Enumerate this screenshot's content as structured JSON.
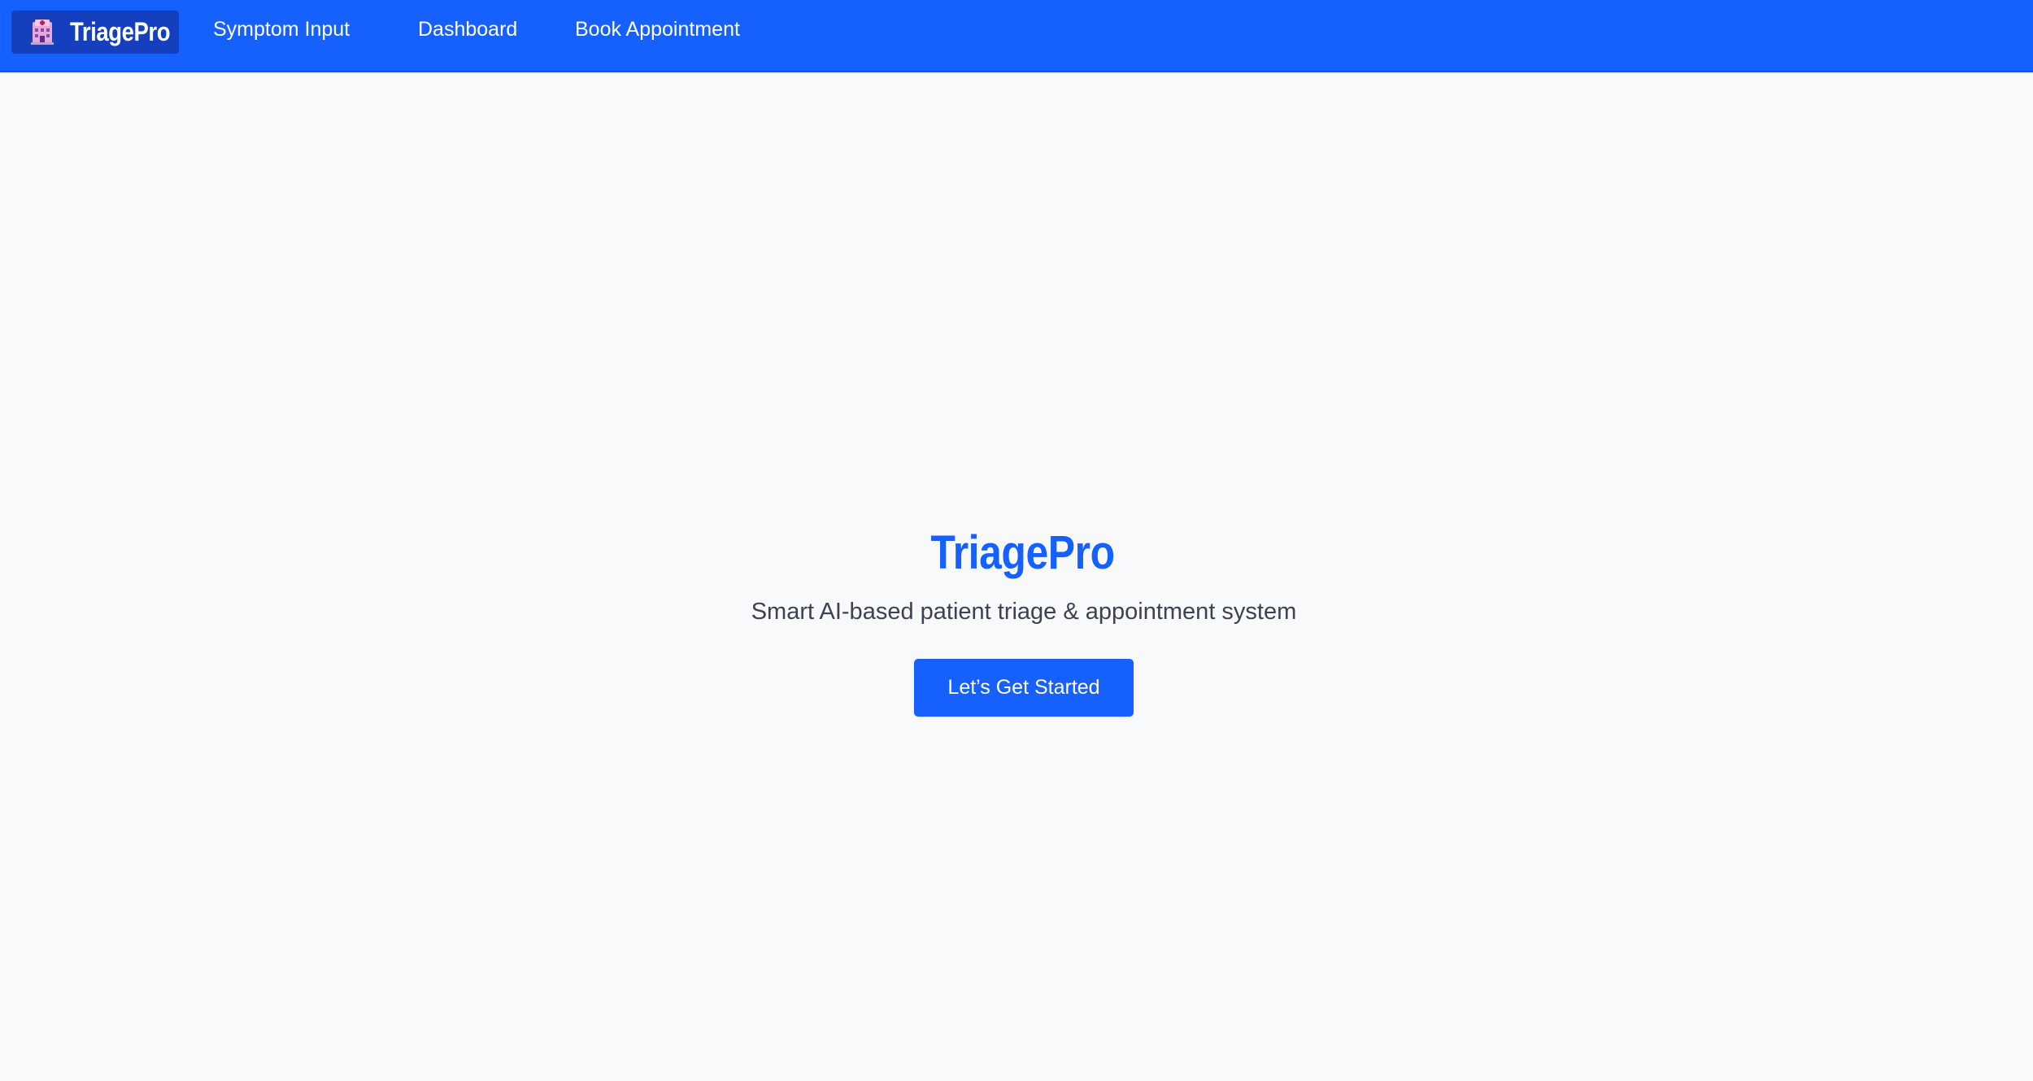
{
  "colors": {
    "primary": "#1660fe",
    "brand_badge": "#163fbd",
    "background": "#f8f9fb",
    "subtitle_text": "#3c4252"
  },
  "navbar": {
    "brand": {
      "icon": "hospital-icon",
      "label": "TriagePro"
    },
    "links": [
      {
        "label": "Symptom Input"
      },
      {
        "label": "Dashboard"
      },
      {
        "label": "Book Appointment"
      }
    ]
  },
  "hero": {
    "title": "TriagePro",
    "subtitle": "Smart AI-based patient triage & appointment system",
    "cta_label": "Let’s Get Started"
  }
}
